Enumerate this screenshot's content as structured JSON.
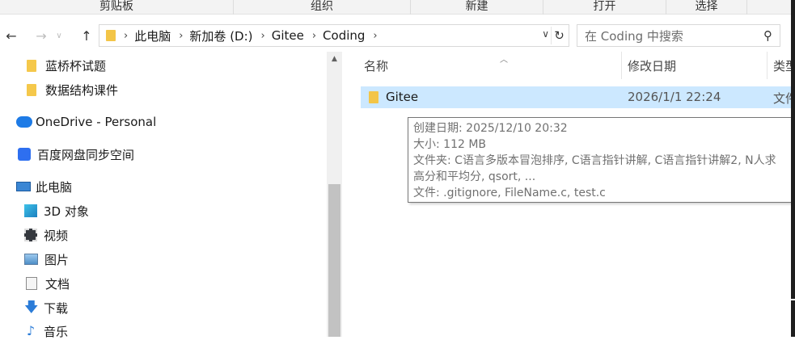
{
  "ribbon": {
    "groups": [
      "剪贴板",
      "组织",
      "新建",
      "打开",
      "选择"
    ]
  },
  "nav": {
    "back_icon": "arrow-left",
    "forward_icon": "arrow-right",
    "up_icon": "arrow-up"
  },
  "address": {
    "crumbs": [
      "此电脑",
      "新加卷 (D:)",
      "Gitee",
      "Coding"
    ]
  },
  "search": {
    "placeholder": "在 Coding 中搜索"
  },
  "navpane": {
    "items": [
      {
        "label": "蓝桥杯试题",
        "icon": "folder-icon"
      },
      {
        "label": "数据结构课件",
        "icon": "folder-icon"
      },
      {
        "label": "OneDrive - Personal",
        "icon": "onedrive-cloud-icon"
      },
      {
        "label": "百度网盘同步空间",
        "icon": "baidu-netdisk-icon"
      },
      {
        "label": "此电脑",
        "icon": "this-pc-icon"
      },
      {
        "label": "3D 对象",
        "icon": "3d-objects-icon"
      },
      {
        "label": "视频",
        "icon": "videos-icon"
      },
      {
        "label": "图片",
        "icon": "pictures-icon"
      },
      {
        "label": "文档",
        "icon": "documents-icon"
      },
      {
        "label": "下载",
        "icon": "downloads-icon"
      },
      {
        "label": "音乐",
        "icon": "music-icon"
      }
    ]
  },
  "filelist": {
    "columns": {
      "name": "名称",
      "modified": "修改日期",
      "type": "类型"
    },
    "rows": [
      {
        "name": "Gitee",
        "modified": "2026/1/1 22:24",
        "type": "文件"
      }
    ]
  },
  "tooltip": {
    "lines": [
      "创建日期: 2025/12/10 20:32",
      "大小: 112 MB",
      "文件夹: C语言多版本冒泡排序, C语言指针讲解, C语言指针讲解2, N人求",
      "高分和平均分, qsort, ...",
      "文件: .gitignore, FileName.c, test.c"
    ]
  },
  "colors": {
    "selected_row": "#cce8ff",
    "folder": "#f3c547",
    "accent": "#1e7be6"
  }
}
